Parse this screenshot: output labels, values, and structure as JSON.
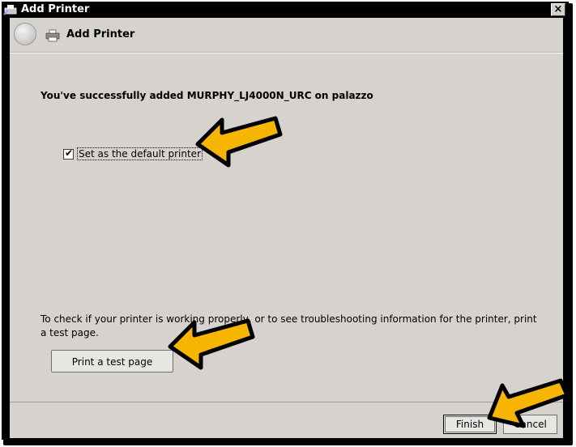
{
  "window": {
    "title": "Add Printer",
    "close_glyph": "×"
  },
  "nav": {
    "back_glyph": "←",
    "title": "Add Printer"
  },
  "main": {
    "headline": "You've successfully added MURPHY_LJ4000N_URC on palazzo",
    "default_checkbox": {
      "label": "Set as the default printer",
      "checked": true,
      "check_glyph": "✔"
    },
    "info_text": "To check if your printer is working properly, or to see troubleshooting information for the printer, print a test page.",
    "test_page_button": "Print a test page"
  },
  "footer": {
    "finish_label": "Finish",
    "cancel_label": "Cancel"
  },
  "colors": {
    "dialog_bg": "#d6d3ce",
    "arrow_fill": "#f5b500",
    "title_bar": "#000000"
  }
}
